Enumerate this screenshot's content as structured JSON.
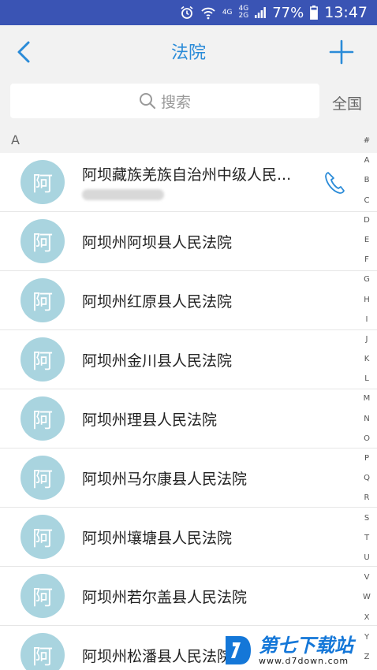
{
  "status_bar": {
    "network_top": "4G",
    "network_mid_top": "4G",
    "network_mid_bottom": "2G",
    "battery": "77%",
    "time": "13:47"
  },
  "header": {
    "title": "法院",
    "back_icon": "chevron-left-icon",
    "add_icon": "plus-icon"
  },
  "search": {
    "placeholder": "搜索",
    "region_label": "全国"
  },
  "section": {
    "letter": "A"
  },
  "courts": [
    {
      "avatar": "阿",
      "name": "阿坝藏族羌族自治州中级人民...",
      "has_phone": true
    },
    {
      "avatar": "阿",
      "name": "阿坝州阿坝县人民法院"
    },
    {
      "avatar": "阿",
      "name": "阿坝州红原县人民法院"
    },
    {
      "avatar": "阿",
      "name": "阿坝州金川县人民法院"
    },
    {
      "avatar": "阿",
      "name": "阿坝州理县人民法院"
    },
    {
      "avatar": "阿",
      "name": "阿坝州马尔康县人民法院"
    },
    {
      "avatar": "阿",
      "name": "阿坝州壤塘县人民法院"
    },
    {
      "avatar": "阿",
      "name": "阿坝州若尔盖县人民法院"
    },
    {
      "avatar": "阿",
      "name": "阿坝州松潘县人民法院"
    }
  ],
  "index_letters": [
    "#",
    "A",
    "B",
    "C",
    "D",
    "E",
    "F",
    "G",
    "H",
    "I",
    "J",
    "K",
    "L",
    "M",
    "N",
    "O",
    "P",
    "Q",
    "R",
    "S",
    "T",
    "U",
    "V",
    "W",
    "X",
    "Y",
    "Z"
  ],
  "watermark": {
    "main": "第七下载站",
    "sub": "www.d7down.com"
  },
  "colors": {
    "status_bar": "#3a54b4",
    "accent": "#2a8bd8",
    "avatar": "#a9d4df",
    "background": "#f2f2f2"
  }
}
